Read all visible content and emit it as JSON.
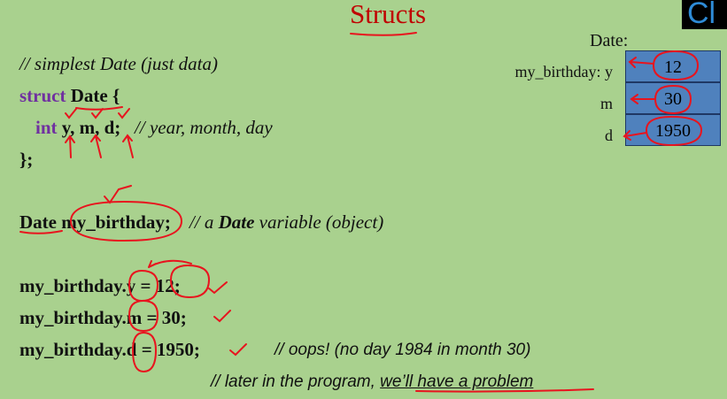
{
  "title": "Structs",
  "corner_text": "Cl",
  "code": {
    "comment1": "// simplest Date (just data)",
    "struct_kw": "struct",
    "struct_name": "Date",
    "struct_open": " {",
    "int_kw": "int",
    "fields": "y, m, d;",
    "fields_comment": "// year, month, day",
    "struct_close": "};",
    "decl_type": "Date",
    "decl_var": "my_birthday;",
    "decl_comment_a": "// a ",
    "decl_comment_b": "Date",
    "decl_comment_c": " variable (object)",
    "assign1": "my_birthday.y = 12;",
    "assign2": "my_birthday.m = 30;",
    "assign3": "my_birthday.d = 1950;",
    "oops_comment": "// oops! (no day 1984 in month 30)",
    "later_comment_a": "// later in the program, ",
    "later_comment_b": "we’ll have a problem"
  },
  "diagram": {
    "title": "Date:",
    "rows": [
      {
        "label": "my_birthday: y",
        "value": "12"
      },
      {
        "label": "m",
        "value": "30"
      },
      {
        "label": "d",
        "value": "1950"
      }
    ],
    "cell_color": "#4f81bd"
  },
  "colors": {
    "background": "#a9d18e",
    "title": "#c00000",
    "keyword": "#7030a0",
    "annotation": "#e8141e"
  }
}
